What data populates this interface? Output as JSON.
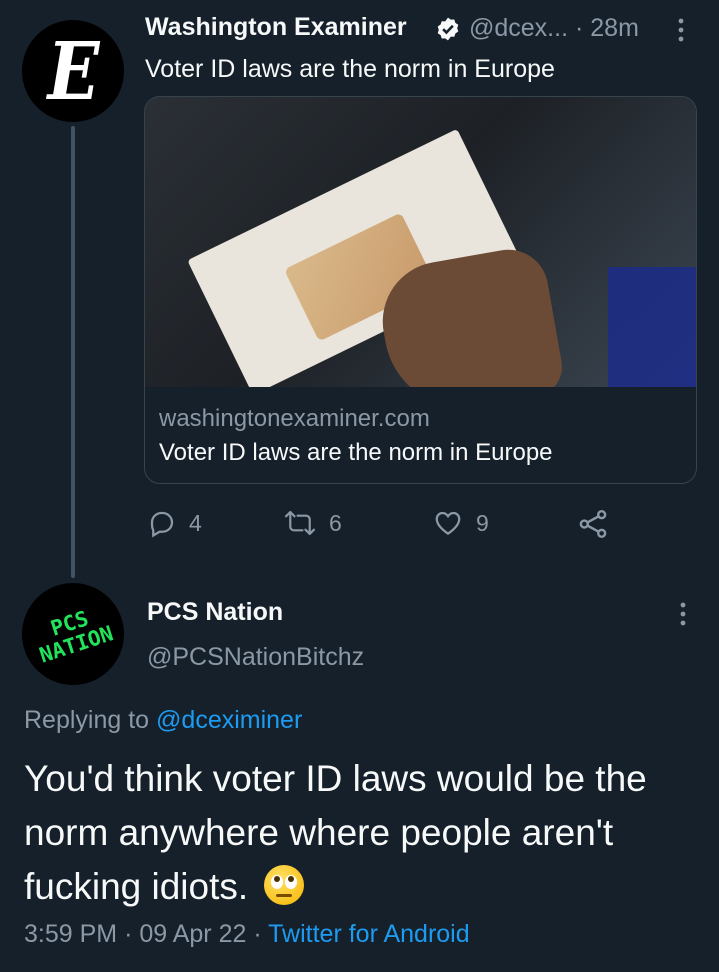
{
  "tweet1": {
    "avatar_letter": "E",
    "name": "Washington Examiner",
    "handle": "@dcex...",
    "separator": "·",
    "time": "28m",
    "text": "Voter ID laws are the norm in Europe",
    "card": {
      "domain": "washingtonexaminer.com",
      "title": "Voter ID laws are the norm in Europe"
    },
    "actions": {
      "replies": "4",
      "retweets": "6",
      "likes": "9"
    }
  },
  "tweet2": {
    "avatar_text": "PCS\nNATION",
    "name": "PCS Nation",
    "handle": "@PCSNationBitchz",
    "replying_prefix": "Replying to ",
    "replying_to": "@dceximiner",
    "text": "You'd think voter ID laws would be the norm anywhere where people aren't fucking idiots.",
    "emoji": "face-with-rolling-eyes",
    "time": "3:59 PM",
    "sep1": "·",
    "date": "09 Apr 22",
    "sep2": "·",
    "source": "Twitter for Android"
  },
  "colors": {
    "background": "#15202b",
    "link": "#1d9bf0",
    "secondary_text": "#8b98a5"
  }
}
